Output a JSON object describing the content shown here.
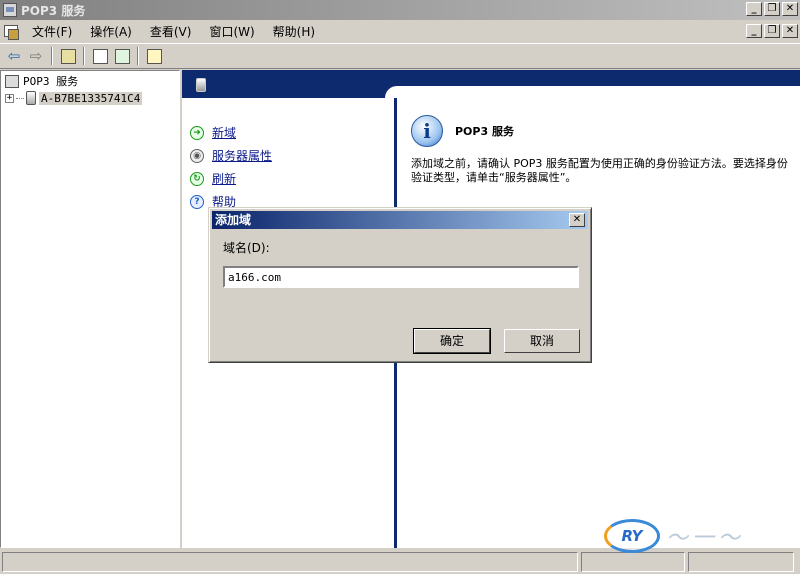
{
  "window": {
    "title": "POP3 服务"
  },
  "menu": {
    "items": [
      "文件(F)",
      "操作(A)",
      "查看(V)",
      "窗口(W)",
      "帮助(H)"
    ]
  },
  "window_buttons": {
    "minimize": "_",
    "restore": "❐",
    "close": "✕"
  },
  "tree": {
    "root_label": "POP3 服务",
    "server_label": "A-B7BE1335741C4"
  },
  "tasks": [
    {
      "label": "新域",
      "icon": "green-arrow-icon"
    },
    {
      "label": "服务器属性",
      "icon": "properties-icon"
    },
    {
      "label": "刷新",
      "icon": "refresh-icon"
    },
    {
      "label": "帮助",
      "icon": "help-icon"
    }
  ],
  "info": {
    "title": "POP3 服务",
    "text": "添加域之前，请确认 POP3 服务配置为使用正确的身份验证方法。要选择身份验证类型，请单击“服务器属性”。"
  },
  "dialog": {
    "title": "添加域",
    "field_label": "域名(D):",
    "field_value": "a166.com",
    "ok": "确定",
    "cancel": "取消"
  },
  "watermark": {
    "logo": "RY"
  }
}
